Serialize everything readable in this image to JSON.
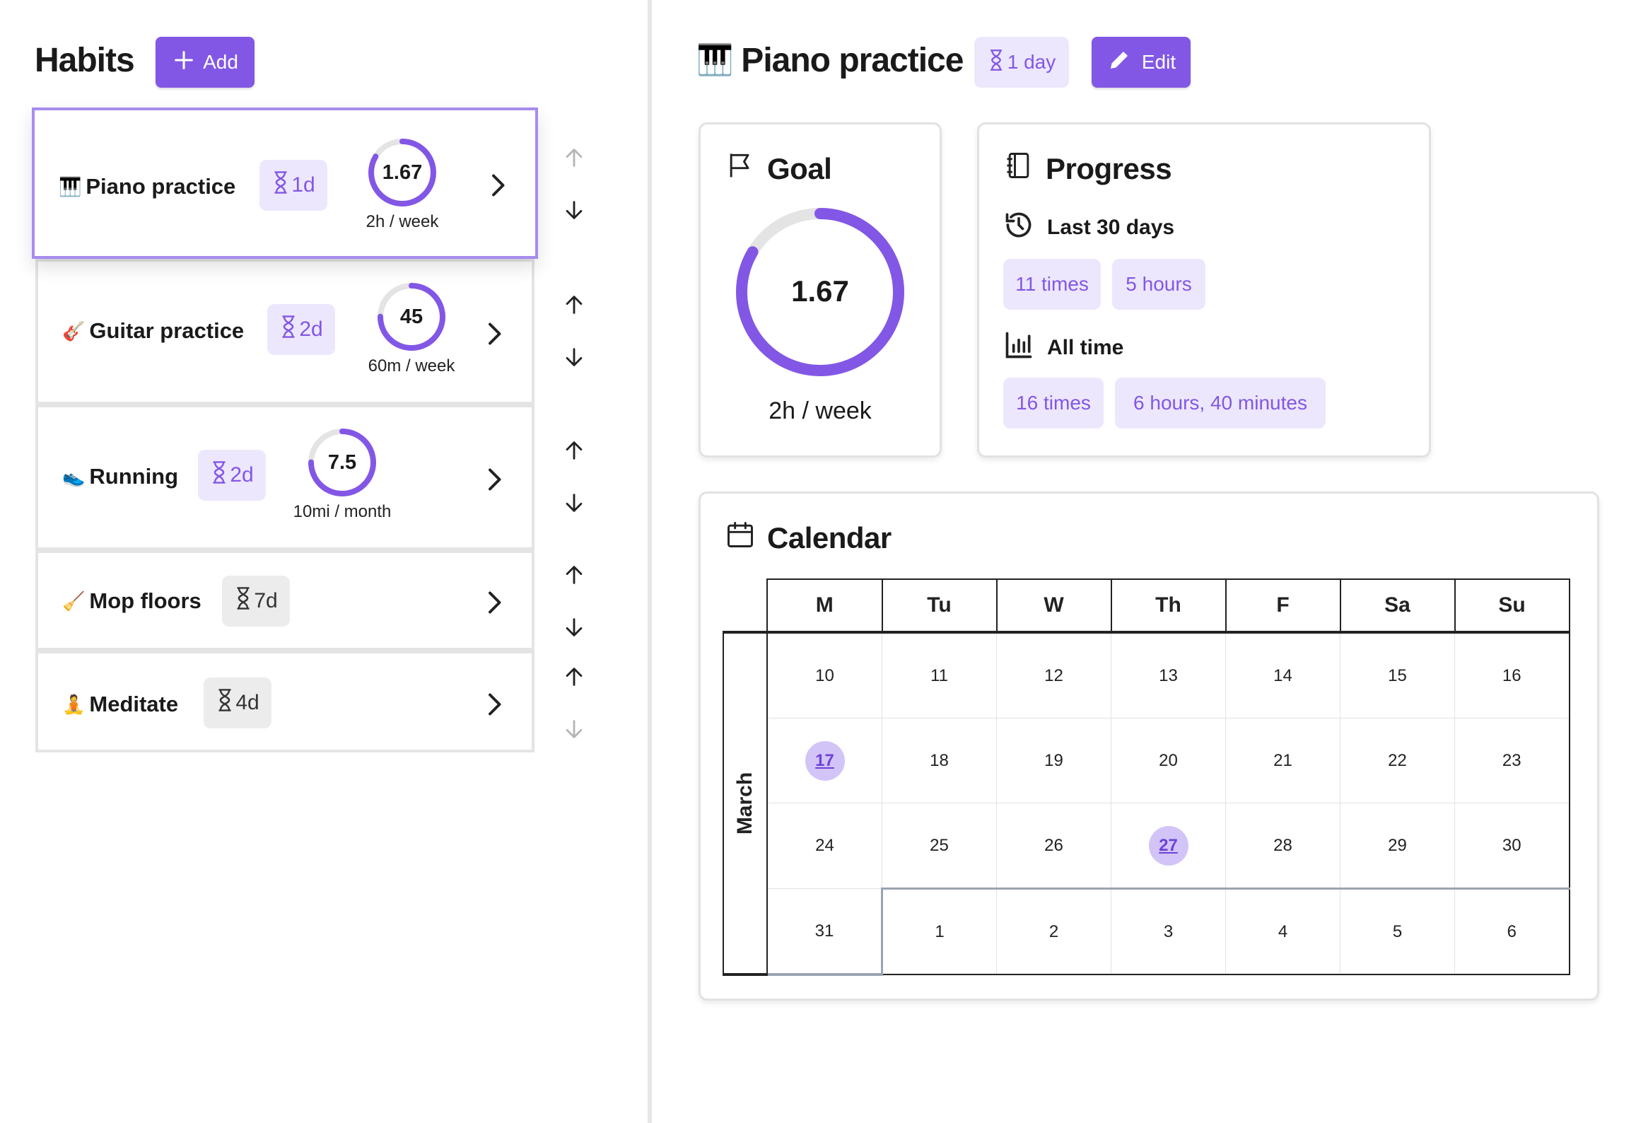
{
  "habits_pane": {
    "title": "Habits",
    "add_label": "Add",
    "items": [
      {
        "emoji": "🎹",
        "name": "Piano practice",
        "interval": "1d",
        "interval_style": "purple",
        "ring_value": "1.67",
        "ring_fraction": 0.835,
        "ring_caption": "2h / week"
      },
      {
        "emoji": "🎸",
        "name": "Guitar practice",
        "interval": "2d",
        "interval_style": "purple",
        "ring_value": "45",
        "ring_fraction": 0.75,
        "ring_caption": "60m / week"
      },
      {
        "emoji": "👟",
        "name": "Running",
        "interval": "2d",
        "interval_style": "purple",
        "ring_value": "7.5",
        "ring_fraction": 0.75,
        "ring_caption": "10mi / month"
      },
      {
        "emoji": "🧹",
        "name": "Mop floors",
        "interval": "7d",
        "interval_style": "gray"
      },
      {
        "emoji": "🧘",
        "name": "Meditate",
        "interval": "4d",
        "interval_style": "gray"
      }
    ]
  },
  "detail": {
    "emoji": "🎹",
    "title": "Piano practice",
    "interval": "1 day",
    "edit_label": "Edit",
    "goal": {
      "title": "Goal",
      "value": "1.67",
      "fraction": 0.835,
      "caption": "2h / week"
    },
    "progress": {
      "title": "Progress",
      "recent": {
        "label": "Last 30 days",
        "times": "11 times",
        "duration": "5 hours"
      },
      "all_time": {
        "label": "All time",
        "times": "16 times",
        "duration": "6 hours, 40 minutes"
      }
    },
    "calendar": {
      "title": "Calendar",
      "month": "March",
      "weekdays": [
        "M",
        "Tu",
        "W",
        "Th",
        "F",
        "Sa",
        "Su"
      ],
      "weeks": [
        [
          "10",
          "11",
          "12",
          "13",
          "14",
          "15",
          "16"
        ],
        [
          "17",
          "18",
          "19",
          "20",
          "21",
          "22",
          "23"
        ],
        [
          "24",
          "25",
          "26",
          "27",
          "28",
          "29",
          "30"
        ],
        [
          "31",
          "1",
          "2",
          "3",
          "4",
          "5",
          "6"
        ]
      ],
      "marked_days": [
        "17",
        "27"
      ]
    }
  },
  "colors": {
    "accent": "#8257e5",
    "accent_light": "#ede7fd",
    "ring_track": "#e4e4e4",
    "marked_day": "#d3c4f8"
  }
}
